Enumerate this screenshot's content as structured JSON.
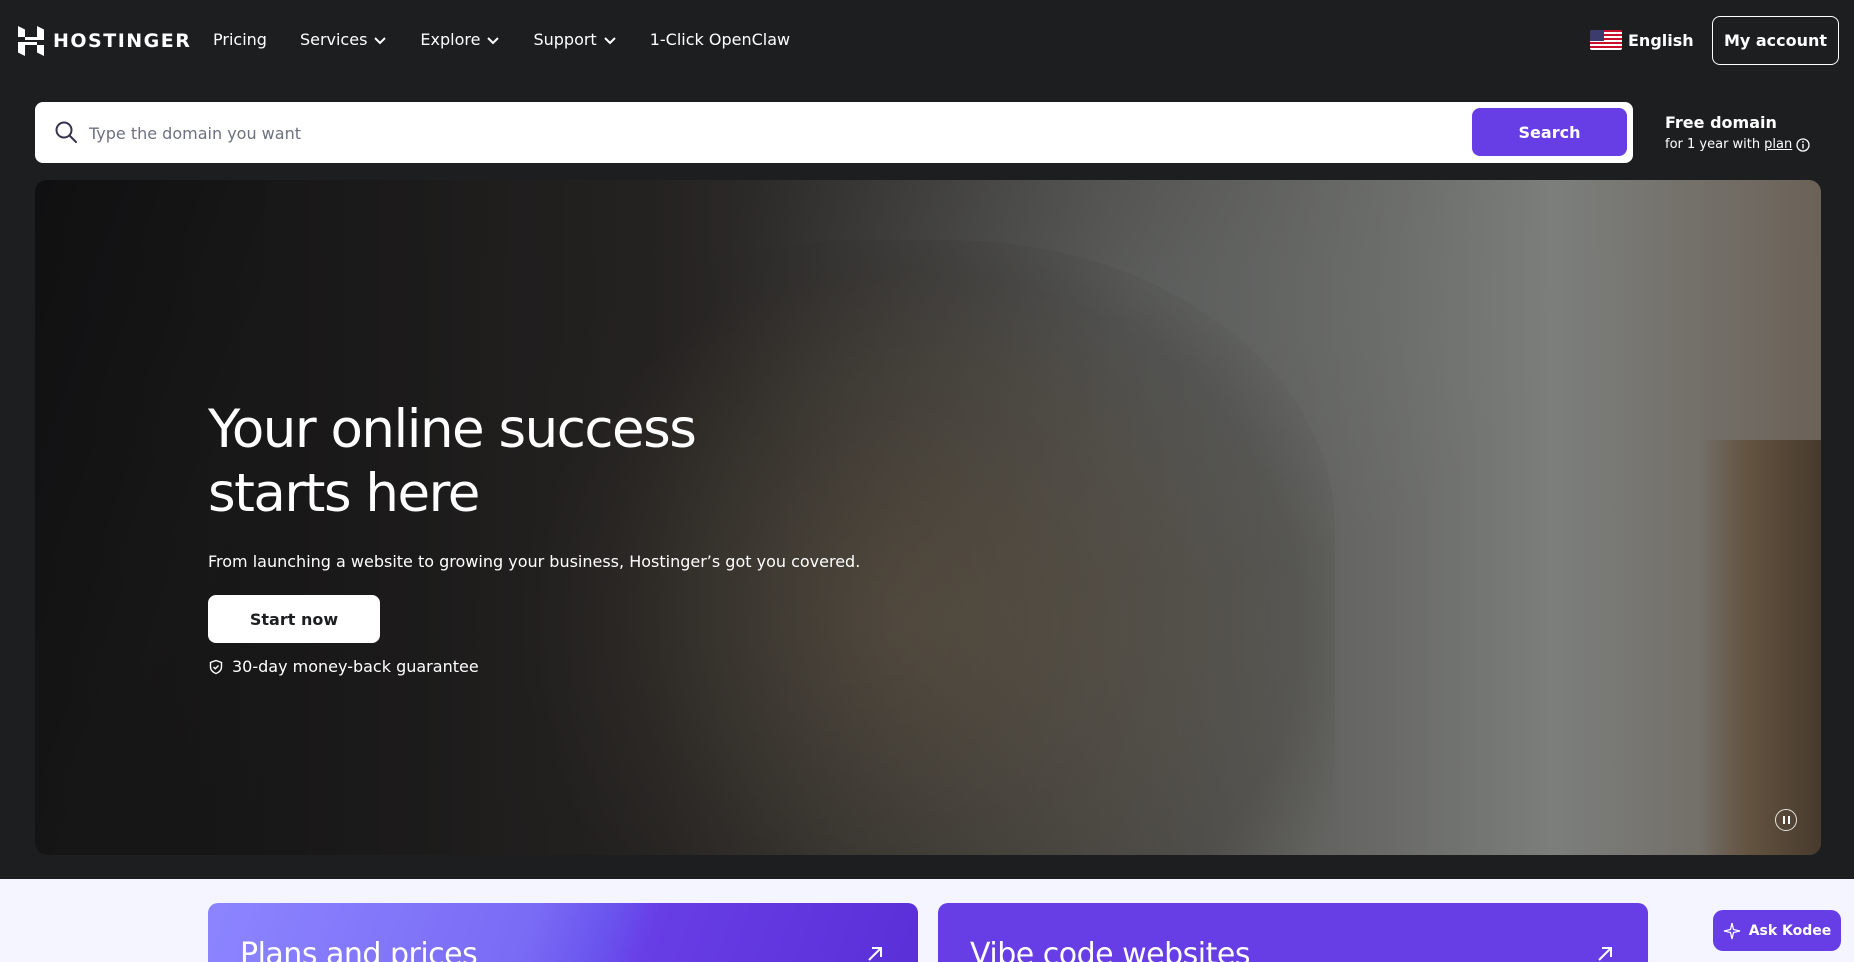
{
  "brand": {
    "name": "HOSTINGER"
  },
  "nav": {
    "links": [
      {
        "label": "Pricing",
        "has_dropdown": false
      },
      {
        "label": "Services",
        "has_dropdown": true
      },
      {
        "label": "Explore",
        "has_dropdown": true
      },
      {
        "label": "Support",
        "has_dropdown": true
      },
      {
        "label": "1-Click OpenClaw",
        "has_dropdown": false
      }
    ],
    "language": "English",
    "account_label": "My account"
  },
  "search": {
    "placeholder": "Type the domain you want",
    "value": "",
    "button_label": "Search",
    "free_domain_title": "Free domain",
    "free_domain_prefix": "for 1 year with",
    "free_domain_link": "plan"
  },
  "hero": {
    "title": "Your online success starts here",
    "subtitle": "From launching a website to growing your business, Hostinger’s got you covered.",
    "cta_label": "Start now",
    "guarantee": "30-day money-back guarantee"
  },
  "cards": [
    {
      "title": "Plans and prices"
    },
    {
      "title": "Vibe code websites"
    }
  ],
  "assistant": {
    "label": "Ask Kodee"
  },
  "colors": {
    "accent": "#673de6",
    "background": "#1d1e20",
    "lower_background": "#f4f5ff"
  }
}
